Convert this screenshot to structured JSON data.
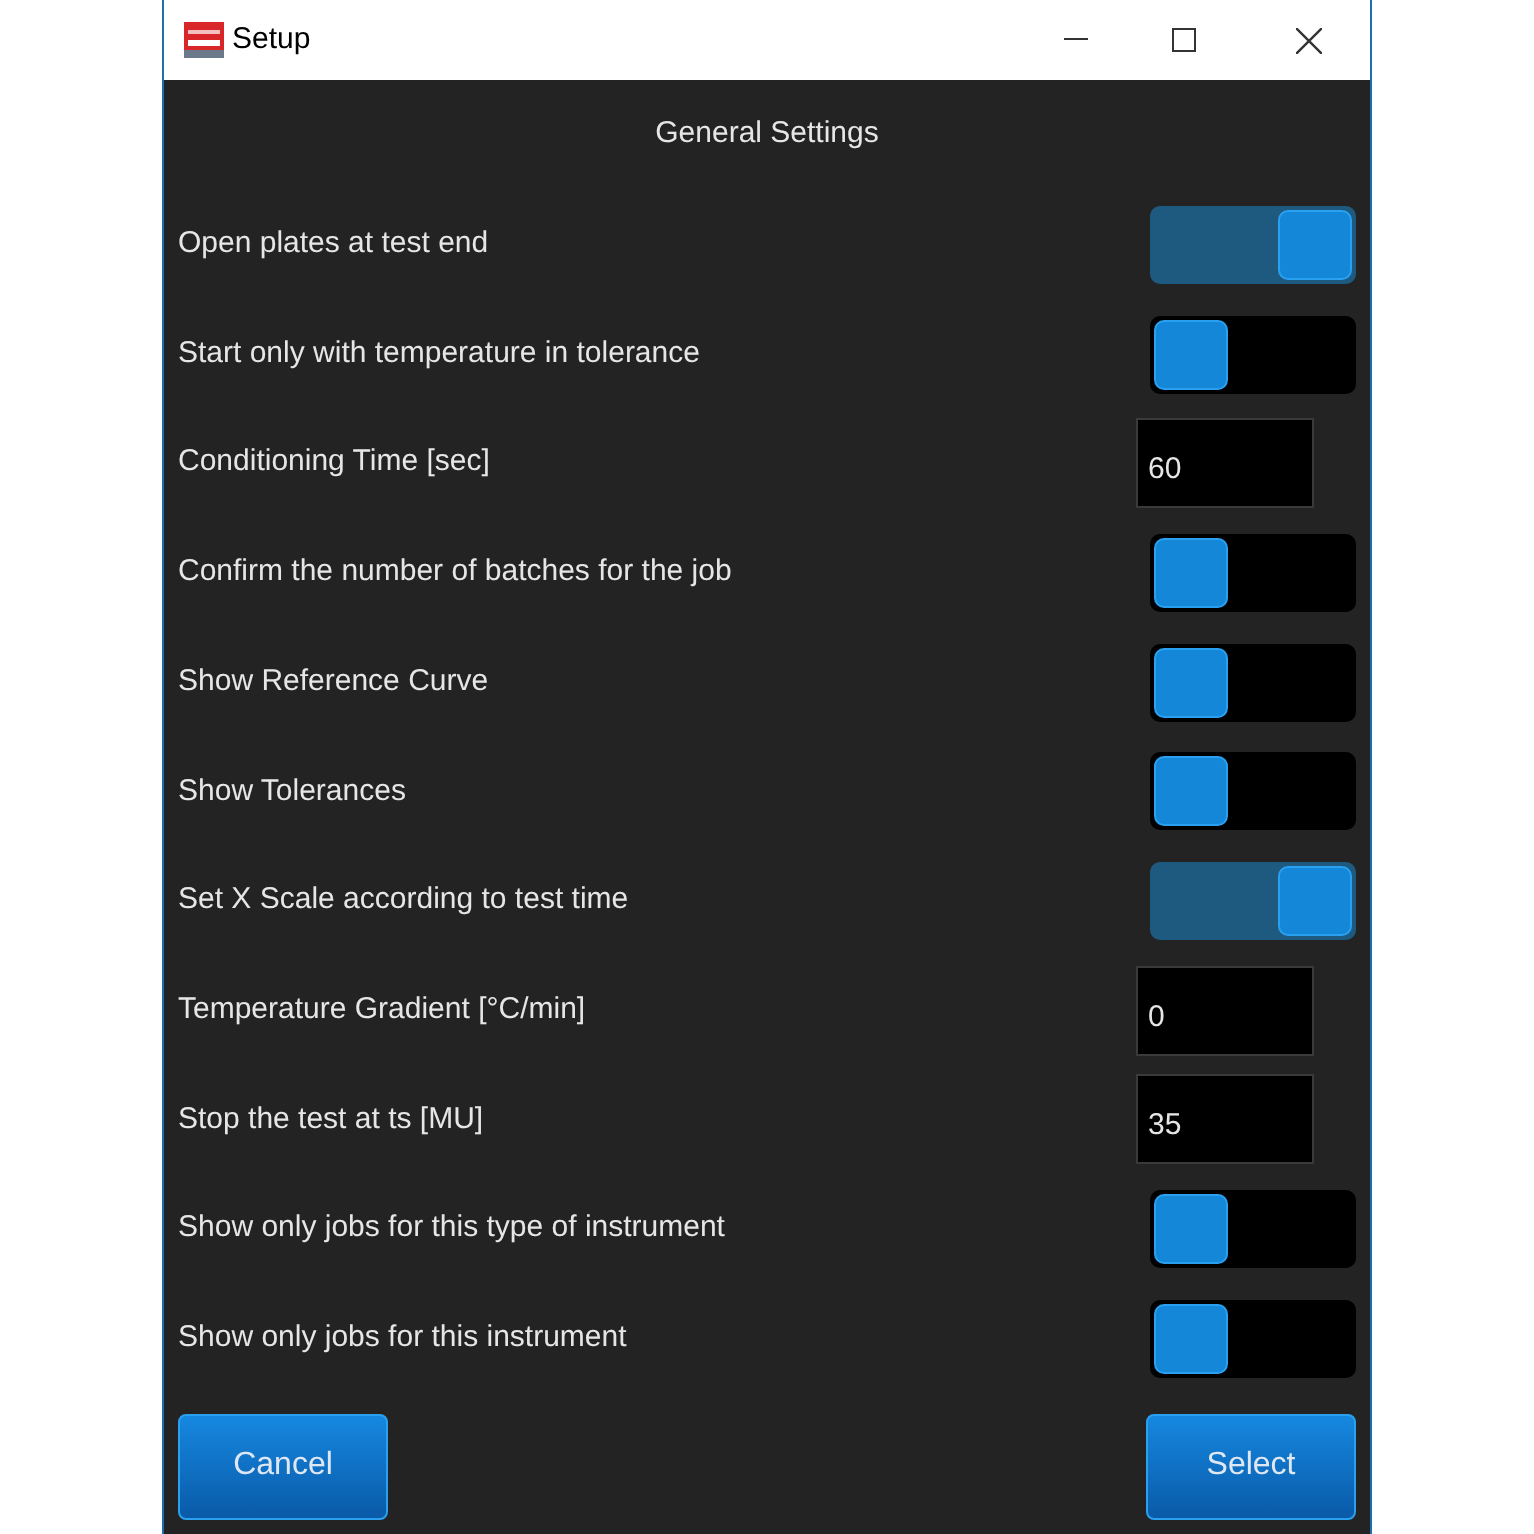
{
  "window": {
    "title": "Setup"
  },
  "heading": "General Settings",
  "settings": [
    {
      "kind": "toggle",
      "label": "Open plates at test end",
      "on": true
    },
    {
      "kind": "toggle",
      "label": "Start only with temperature in tolerance",
      "on": false
    },
    {
      "kind": "field",
      "label": "Conditioning Time [sec]",
      "value": "60"
    },
    {
      "kind": "toggle",
      "label": "Confirm the number of batches for the job",
      "on": false
    },
    {
      "kind": "toggle",
      "label": "Show Reference Curve",
      "on": false
    },
    {
      "kind": "toggle",
      "label": "Show Tolerances",
      "on": false
    },
    {
      "kind": "toggle",
      "label": "Set X Scale according to test time",
      "on": true
    },
    {
      "kind": "field",
      "label": "Temperature Gradient [°C/min]",
      "value": "0"
    },
    {
      "kind": "field",
      "label": "Stop the test at ts [MU]",
      "value": "35"
    },
    {
      "kind": "toggle",
      "label": "Show only jobs for this type of instrument",
      "on": false
    },
    {
      "kind": "toggle",
      "label": "Show only jobs for this instrument",
      "on": false
    }
  ],
  "buttons": [
    {
      "label": "Cancel"
    },
    {
      "label": "Select"
    }
  ]
}
